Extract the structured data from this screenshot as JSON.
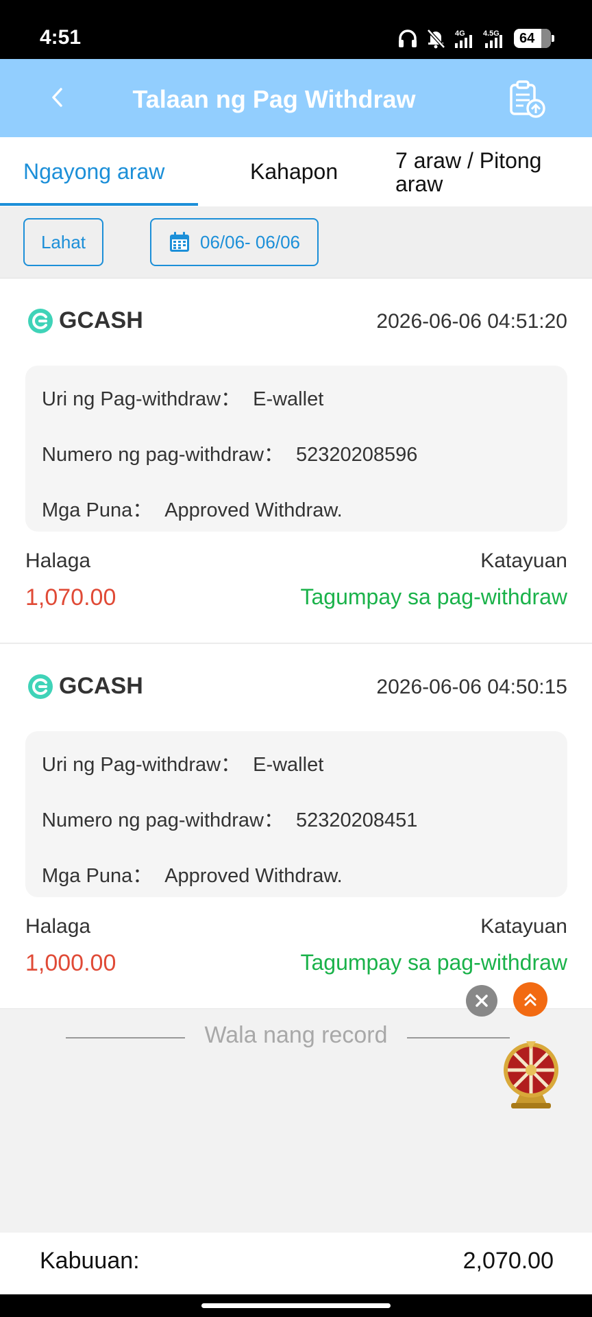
{
  "status_bar": {
    "time": "4:51",
    "network_1": "4G",
    "network_2": "4.5G",
    "battery": "64"
  },
  "header": {
    "title": "Talaan ng Pag Withdraw",
    "back_icon": "chevron-left-icon",
    "export_icon": "clipboard-upload-icon"
  },
  "tabs": [
    {
      "label": "Ngayong araw",
      "active": true
    },
    {
      "label": "Kahapon",
      "active": false
    },
    {
      "label": "7 araw / Pitong araw",
      "active": false
    }
  ],
  "filters": {
    "all_label": "Lahat",
    "date_range": "06/06- 06/06",
    "date_icon": "calendar-icon"
  },
  "records": [
    {
      "method": "GCASH",
      "datetime": "2026-06-06 04:51:20",
      "type_label": "Uri ng Pag-withdraw：",
      "type_value": "E-wallet",
      "number_label": "Numero ng pag-withdraw：",
      "number_value": "52320208596",
      "remarks_label": "Mga Puna：",
      "remarks_value": "Approved Withdraw.",
      "amount_label": "Halaga",
      "amount_value": "1,070.00",
      "status_label": "Katayuan",
      "status_value": "Tagumpay sa pag-withdraw"
    },
    {
      "method": "GCASH",
      "datetime": "2026-06-06 04:50:15",
      "type_label": "Uri ng Pag-withdraw：",
      "type_value": "E-wallet",
      "number_label": "Numero ng pag-withdraw：",
      "number_value": "52320208451",
      "remarks_label": "Mga Puna：",
      "remarks_value": "Approved Withdraw.",
      "amount_label": "Halaga",
      "amount_value": "1,000.00",
      "status_label": "Katayuan",
      "status_value": "Tagumpay sa pag-withdraw"
    }
  ],
  "empty_state": {
    "text": "Wala nang record"
  },
  "total": {
    "label": "Kabuuan:",
    "value": "2,070.00"
  },
  "colors": {
    "header_bg": "#92cefe",
    "accent": "#1c8fd8",
    "amount": "#e04a36",
    "success": "#1ab24a",
    "gcash": "#3fd3b8"
  }
}
